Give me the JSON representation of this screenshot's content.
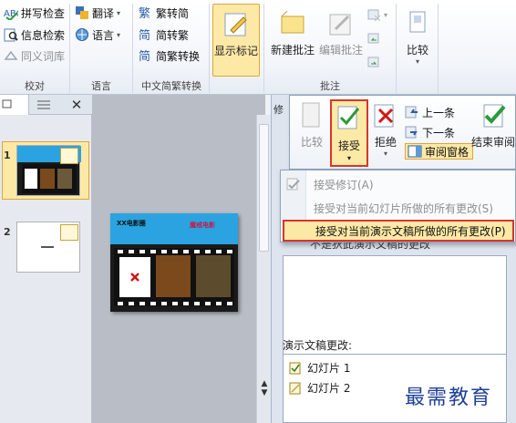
{
  "ribbon": {
    "proofing": {
      "label": "校对",
      "items": [
        "拼写检查",
        "信息检索",
        "同义词库"
      ]
    },
    "language": {
      "label": "语言",
      "items": [
        "翻译",
        "语言"
      ]
    },
    "chinese": {
      "label": "中文简繁转换",
      "items": [
        "简转繁",
        "简转繁",
        "简繁转换"
      ],
      "items_shown": [
        "繁转简",
        "简转繁",
        "简繁转换"
      ]
    },
    "markup": {
      "show_markup": "显示标记"
    },
    "comments": {
      "label": "批注",
      "new_comment": "新建批注",
      "edit_comment": "编辑批注"
    },
    "compare": {
      "label": "比较"
    }
  },
  "popup": {
    "compare": "比较",
    "accept": "接受",
    "reject": "拒绝",
    "previous": "上一条",
    "next": "下一条",
    "reviewing_pane": "审阅窗格",
    "end_review": "结束审阅"
  },
  "accept_menu": {
    "items": [
      {
        "label": "接受修订(A)"
      },
      {
        "label": "接受对当前幻灯片所做的所有更改(S)"
      },
      {
        "label": "接受对当前演示文稿所做的所有更改(P)"
      }
    ],
    "under_text": "不是狄此演示文稿的更改"
  },
  "side_panel": {
    "slide1": "1",
    "slide2": "2"
  },
  "slide": {
    "title_text": "XX电影圈",
    "stamp_text": "魔戒电影"
  },
  "review_pane": {
    "header_initial": "修",
    "changes_label": "演示文稿更改:",
    "slides": [
      "幻灯片 1",
      "幻灯片 2"
    ],
    "watermark": "最需教育"
  },
  "colors": {
    "accent_yellow": "#fde9a6",
    "accent_border": "#e0a43a",
    "menu_highlight": "#fde9a6",
    "red_highlight": "#d9352b",
    "slide_blue": "#2aa3e0"
  }
}
